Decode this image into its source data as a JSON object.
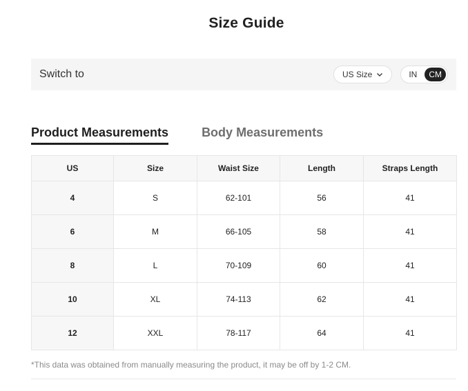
{
  "title": "Size Guide",
  "switch_bar": {
    "label": "Switch to",
    "size_select": {
      "value": "US Size"
    },
    "units": [
      {
        "label": "IN",
        "active": false
      },
      {
        "label": "CM",
        "active": true
      }
    ]
  },
  "tabs": [
    {
      "label": "Product Measurements",
      "active": true
    },
    {
      "label": "Body Measurements",
      "active": false
    }
  ],
  "table": {
    "headers": [
      "US",
      "Size",
      "Waist Size",
      "Length",
      "Straps Length"
    ],
    "rows": [
      [
        "4",
        "S",
        "62-101",
        "56",
        "41"
      ],
      [
        "6",
        "M",
        "66-105",
        "58",
        "41"
      ],
      [
        "8",
        "L",
        "70-109",
        "60",
        "41"
      ],
      [
        "10",
        "XL",
        "74-113",
        "62",
        "41"
      ],
      [
        "12",
        "XXL",
        "78-117",
        "64",
        "41"
      ]
    ]
  },
  "footnote": "*This data was obtained from manually measuring the product, it may be off by 1-2 CM.",
  "icons": {
    "size_select_caret": "chevron-down-icon"
  },
  "colors": {
    "active_toggle_bg": "#222222",
    "bar_bg": "#f5f5f5"
  }
}
